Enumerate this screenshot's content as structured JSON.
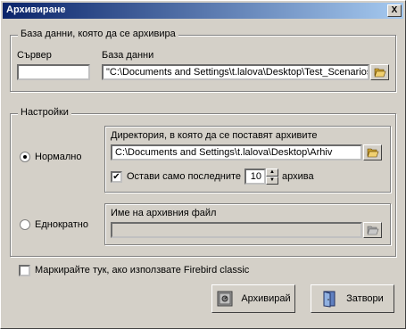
{
  "window": {
    "title": "Архивиране",
    "close_glyph": "X"
  },
  "database_group": {
    "legend": "База данни, която да се архивира",
    "server_label": "Сървер",
    "server_value": "",
    "db_label": "База данни",
    "db_value": "\"C:\\Documents and Settings\\t.lalova\\Desktop\\Test_Scenarios"
  },
  "settings_group": {
    "legend": "Настройки",
    "normal_label": "Нормално",
    "once_label": "Еднократно",
    "normal_selected": true,
    "dir_legend": "Директория, в която да се поставят архивите",
    "dir_value": "C:\\Documents and Settings\\t.lalova\\Desktop\\Arhiv",
    "keep_last_label": "Остави само последните",
    "keep_last_checked": true,
    "keep_last_count": "10",
    "keep_last_unit": "архива",
    "filename_legend": "Име на архивния файл",
    "filename_value": ""
  },
  "firebird_checkbox": {
    "label": "Маркирайте тук, ако използвате Firebird classic",
    "checked": false
  },
  "buttons": {
    "archive": "Архивирай",
    "close": "Затвори"
  }
}
